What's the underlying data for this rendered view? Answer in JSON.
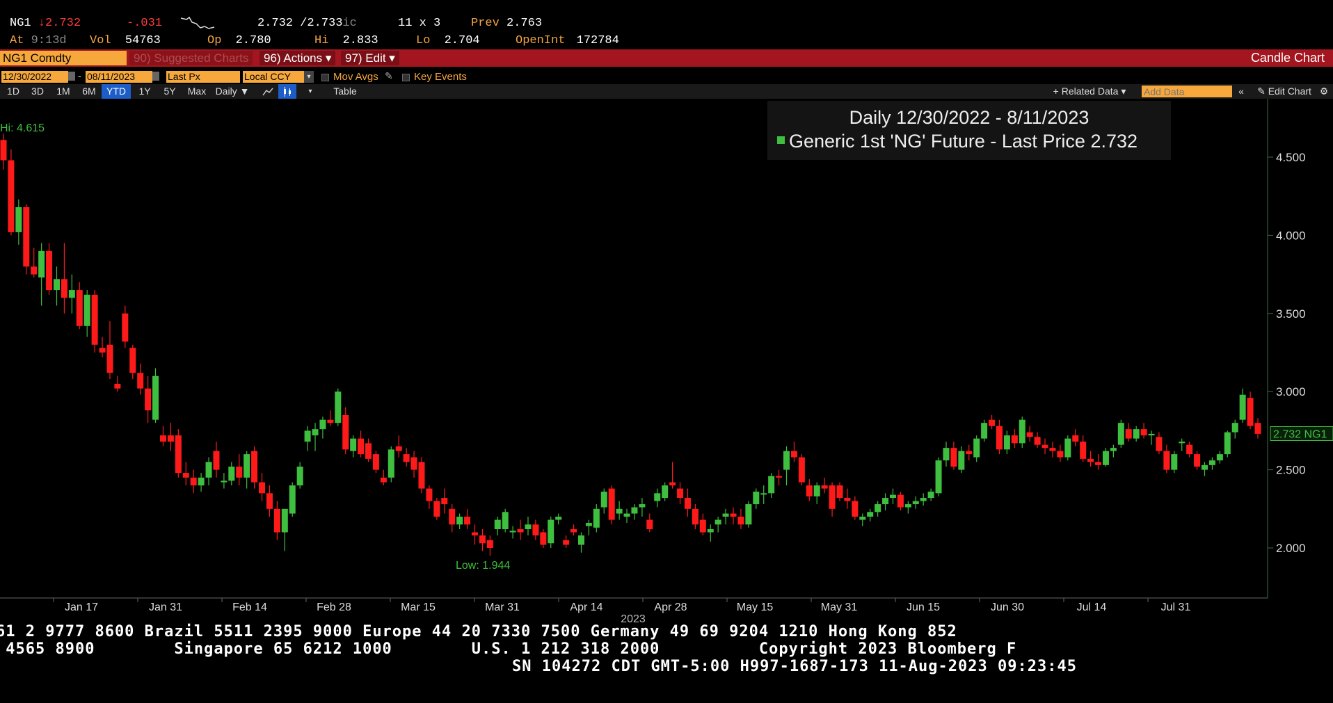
{
  "quote": {
    "ticker": "NG1",
    "arrow": "↓",
    "last": "2.732",
    "change": "-.031",
    "bid_ask": "2.732 /2.733",
    "bid_ask_suffix": "ic",
    "size": "11 x 3",
    "prev_label": "Prev",
    "prev": "2.763",
    "at_label": "At",
    "time": "9:13",
    "time_suffix": "d",
    "vol_label": "Vol",
    "vol": "54763",
    "op_label": "Op",
    "op": "2.780",
    "hi_label": "Hi",
    "hi": "2.833",
    "lo_label": "Lo",
    "lo": "2.704",
    "oi_label": "OpenInt",
    "oi": "172784"
  },
  "menu": {
    "security": "NG1 Comdty",
    "suggested": "90) Suggested Charts",
    "actions": "96) Actions ▾",
    "edit": "97) Edit ▾",
    "chart_type": "Candle Chart"
  },
  "options": {
    "start_date": "12/30/2022",
    "sep": "-",
    "end_date": "08/11/2023",
    "field": "Last Px",
    "currency": "Local CCY",
    "mov_avgs": "Mov Avgs",
    "key_events": "Key Events"
  },
  "ranges": [
    "1D",
    "3D",
    "1M",
    "6M",
    "YTD",
    "1Y",
    "5Y",
    "Max"
  ],
  "active_range": "YTD",
  "toolbar": {
    "period": "Daily ▼",
    "table": "Table",
    "related": "+ Related Data ▾",
    "add_data_placeholder": "Add Data",
    "edit_chart": "Edit Chart"
  },
  "legend": {
    "title": "Daily 12/30/2022 - 8/11/2023",
    "series": "Generic 1st 'NG' Future - Last Price",
    "value": "2.732"
  },
  "colors": {
    "up": "#3fbf3f",
    "down": "#ff1a1a",
    "menu": "#a3161f",
    "accent": "#f7a83c"
  },
  "chart_data": {
    "type": "candlestick",
    "y_ticks": [
      "4.500",
      "4.000",
      "3.500",
      "3.000",
      "2.500",
      "2.000"
    ],
    "ylim": [
      1.72,
      4.9
    ],
    "x_tick_labels": [
      "Jan 17",
      "Jan 31",
      "Feb 14",
      "Feb 28",
      "Mar 15",
      "Mar 31",
      "Apr 14",
      "Apr 28",
      "May 15",
      "May 31",
      "Jun 15",
      "Jun 30",
      "Jul 14",
      "Jul 31"
    ],
    "year_label": "2023",
    "hi_annotation": "Hi: 4.615",
    "low_annotation": "Low: 1.944",
    "last_price_tag": "2.732 NG1",
    "candles": [
      [
        4.61,
        4.65,
        4.42,
        4.48
      ],
      [
        4.48,
        4.55,
        4.0,
        4.02
      ],
      [
        4.02,
        4.23,
        3.94,
        4.18
      ],
      [
        4.18,
        4.2,
        3.75,
        3.8
      ],
      [
        3.8,
        3.92,
        3.73,
        3.75
      ],
      [
        3.73,
        3.95,
        3.55,
        3.9
      ],
      [
        3.9,
        3.95,
        3.62,
        3.65
      ],
      [
        3.65,
        3.8,
        3.55,
        3.72
      ],
      [
        3.72,
        3.95,
        3.5,
        3.6
      ],
      [
        3.6,
        3.75,
        3.5,
        3.65
      ],
      [
        3.65,
        3.7,
        3.4,
        3.42
      ],
      [
        3.42,
        3.65,
        3.35,
        3.62
      ],
      [
        3.62,
        3.65,
        3.25,
        3.3
      ],
      [
        3.28,
        3.35,
        3.22,
        3.25
      ],
      [
        3.3,
        3.45,
        3.08,
        3.12
      ],
      [
        3.05,
        3.1,
        3.0,
        3.02
      ],
      [
        3.5,
        3.55,
        3.28,
        3.32
      ],
      [
        3.28,
        3.3,
        3.08,
        3.12
      ],
      [
        3.12,
        3.18,
        2.98,
        3.02
      ],
      [
        3.02,
        3.1,
        2.8,
        2.88
      ],
      [
        2.82,
        3.15,
        2.8,
        3.1
      ],
      [
        2.72,
        2.78,
        2.65,
        2.68
      ],
      [
        2.72,
        2.8,
        2.62,
        2.68
      ],
      [
        2.72,
        2.76,
        2.45,
        2.48
      ],
      [
        2.48,
        2.55,
        2.4,
        2.45
      ],
      [
        2.45,
        2.5,
        2.35,
        2.4
      ],
      [
        2.4,
        2.48,
        2.36,
        2.45
      ],
      [
        2.45,
        2.58,
        2.4,
        2.55
      ],
      [
        2.62,
        2.68,
        2.45,
        2.5
      ],
      [
        2.42,
        2.48,
        2.38,
        2.43
      ],
      [
        2.43,
        2.55,
        2.4,
        2.52
      ],
      [
        2.52,
        2.6,
        2.4,
        2.45
      ],
      [
        2.45,
        2.62,
        2.38,
        2.6
      ],
      [
        2.62,
        2.65,
        2.38,
        2.42
      ],
      [
        2.42,
        2.48,
        2.3,
        2.35
      ],
      [
        2.35,
        2.4,
        2.2,
        2.25
      ],
      [
        2.25,
        2.3,
        2.05,
        2.1
      ],
      [
        2.1,
        2.15,
        1.98,
        2.25
      ],
      [
        2.22,
        2.42,
        2.2,
        2.4
      ],
      [
        2.4,
        2.55,
        2.38,
        2.52
      ],
      [
        2.68,
        2.78,
        2.62,
        2.75
      ],
      [
        2.72,
        2.8,
        2.62,
        2.76
      ],
      [
        2.76,
        2.84,
        2.7,
        2.82
      ],
      [
        2.82,
        2.88,
        2.78,
        2.8
      ],
      [
        2.8,
        3.02,
        2.78,
        3.0
      ],
      [
        2.85,
        2.9,
        2.6,
        2.63
      ],
      [
        2.62,
        2.72,
        2.58,
        2.7
      ],
      [
        2.7,
        2.75,
        2.58,
        2.6
      ],
      [
        2.67,
        2.7,
        2.55,
        2.57
      ],
      [
        2.6,
        2.62,
        2.48,
        2.5
      ],
      [
        2.45,
        2.5,
        2.4,
        2.42
      ],
      [
        2.45,
        2.65,
        2.42,
        2.63
      ],
      [
        2.65,
        2.72,
        2.58,
        2.62
      ],
      [
        2.6,
        2.64,
        2.52,
        2.55
      ],
      [
        2.58,
        2.62,
        2.45,
        2.5
      ],
      [
        2.55,
        2.58,
        2.35,
        2.38
      ],
      [
        2.38,
        2.4,
        2.25,
        2.3
      ],
      [
        2.3,
        2.32,
        2.18,
        2.2
      ],
      [
        2.32,
        2.38,
        2.22,
        2.28
      ],
      [
        2.25,
        2.28,
        2.1,
        2.15
      ],
      [
        2.15,
        2.22,
        2.12,
        2.2
      ],
      [
        2.2,
        2.25,
        2.12,
        2.15
      ],
      [
        2.1,
        2.15,
        2.02,
        2.08
      ],
      [
        2.08,
        2.12,
        1.98,
        2.03
      ],
      [
        2.05,
        2.08,
        1.95,
        2.0
      ],
      [
        2.12,
        2.2,
        2.08,
        2.18
      ],
      [
        2.12,
        2.25,
        2.1,
        2.23
      ],
      [
        2.1,
        2.14,
        2.06,
        2.11
      ],
      [
        2.12,
        2.18,
        2.05,
        2.1
      ],
      [
        2.12,
        2.2,
        2.08,
        2.15
      ],
      [
        2.15,
        2.18,
        2.05,
        2.08
      ],
      [
        2.1,
        2.12,
        2.0,
        2.02
      ],
      [
        2.03,
        2.2,
        2.0,
        2.18
      ],
      [
        2.18,
        2.22,
        2.15,
        2.2
      ],
      [
        2.05,
        2.08,
        2.0,
        2.02
      ],
      [
        2.12,
        2.15,
        2.08,
        2.1
      ],
      [
        2.02,
        2.1,
        1.97,
        2.08
      ],
      [
        2.14,
        2.18,
        2.08,
        2.16
      ],
      [
        2.13,
        2.28,
        2.1,
        2.25
      ],
      [
        2.26,
        2.38,
        2.22,
        2.36
      ],
      [
        2.38,
        2.4,
        2.15,
        2.18
      ],
      [
        2.22,
        2.3,
        2.18,
        2.25
      ],
      [
        2.2,
        2.25,
        2.16,
        2.22
      ],
      [
        2.22,
        2.28,
        2.18,
        2.26
      ],
      [
        2.26,
        2.32,
        2.2,
        2.28
      ],
      [
        2.18,
        2.22,
        2.1,
        2.12
      ],
      [
        2.3,
        2.38,
        2.26,
        2.35
      ],
      [
        2.32,
        2.42,
        2.3,
        2.4
      ],
      [
        2.42,
        2.55,
        2.38,
        2.4
      ],
      [
        2.38,
        2.42,
        2.28,
        2.32
      ],
      [
        2.32,
        2.38,
        2.2,
        2.25
      ],
      [
        2.25,
        2.28,
        2.12,
        2.15
      ],
      [
        2.18,
        2.22,
        2.08,
        2.1
      ],
      [
        2.1,
        2.15,
        2.04,
        2.12
      ],
      [
        2.15,
        2.2,
        2.1,
        2.18
      ],
      [
        2.2,
        2.25,
        2.15,
        2.22
      ],
      [
        2.22,
        2.26,
        2.15,
        2.2
      ],
      [
        2.2,
        2.25,
        2.12,
        2.15
      ],
      [
        2.15,
        2.3,
        2.13,
        2.28
      ],
      [
        2.28,
        2.38,
        2.25,
        2.36
      ],
      [
        2.35,
        2.4,
        2.28,
        2.35
      ],
      [
        2.35,
        2.48,
        2.32,
        2.46
      ],
      [
        2.46,
        2.5,
        2.4,
        2.45
      ],
      [
        2.5,
        2.65,
        2.4,
        2.62
      ],
      [
        2.62,
        2.68,
        2.55,
        2.58
      ],
      [
        2.58,
        2.6,
        2.4,
        2.42
      ],
      [
        2.4,
        2.44,
        2.3,
        2.33
      ],
      [
        2.33,
        2.42,
        2.28,
        2.4
      ],
      [
        2.4,
        2.45,
        2.35,
        2.38
      ],
      [
        2.4,
        2.42,
        2.2,
        2.25
      ],
      [
        2.4,
        2.42,
        2.3,
        2.32
      ],
      [
        2.32,
        2.38,
        2.25,
        2.3
      ],
      [
        2.3,
        2.33,
        2.18,
        2.2
      ],
      [
        2.18,
        2.22,
        2.14,
        2.2
      ],
      [
        2.2,
        2.25,
        2.17,
        2.23
      ],
      [
        2.23,
        2.3,
        2.2,
        2.28
      ],
      [
        2.28,
        2.35,
        2.24,
        2.32
      ],
      [
        2.32,
        2.38,
        2.28,
        2.34
      ],
      [
        2.34,
        2.36,
        2.24,
        2.26
      ],
      [
        2.26,
        2.3,
        2.22,
        2.28
      ],
      [
        2.28,
        2.33,
        2.25,
        2.3
      ],
      [
        2.3,
        2.35,
        2.27,
        2.32
      ],
      [
        2.32,
        2.38,
        2.3,
        2.36
      ],
      [
        2.35,
        2.58,
        2.33,
        2.56
      ],
      [
        2.56,
        2.68,
        2.52,
        2.64
      ],
      [
        2.64,
        2.68,
        2.5,
        2.52
      ],
      [
        2.5,
        2.65,
        2.48,
        2.62
      ],
      [
        2.62,
        2.66,
        2.56,
        2.6
      ],
      [
        2.58,
        2.72,
        2.55,
        2.7
      ],
      [
        2.7,
        2.82,
        2.68,
        2.8
      ],
      [
        2.82,
        2.85,
        2.76,
        2.78
      ],
      [
        2.78,
        2.82,
        2.6,
        2.63
      ],
      [
        2.63,
        2.75,
        2.6,
        2.72
      ],
      [
        2.72,
        2.76,
        2.64,
        2.67
      ],
      [
        2.67,
        2.84,
        2.64,
        2.82
      ],
      [
        2.74,
        2.78,
        2.68,
        2.71
      ],
      [
        2.71,
        2.74,
        2.64,
        2.66
      ],
      [
        2.66,
        2.7,
        2.6,
        2.64
      ],
      [
        2.64,
        2.68,
        2.58,
        2.62
      ],
      [
        2.62,
        2.66,
        2.55,
        2.58
      ],
      [
        2.58,
        2.72,
        2.56,
        2.7
      ],
      [
        2.72,
        2.76,
        2.65,
        2.68
      ],
      [
        2.68,
        2.72,
        2.55,
        2.57
      ],
      [
        2.57,
        2.62,
        2.52,
        2.55
      ],
      [
        2.55,
        2.6,
        2.5,
        2.53
      ],
      [
        2.53,
        2.64,
        2.52,
        2.62
      ],
      [
        2.62,
        2.66,
        2.58,
        2.64
      ],
      [
        2.66,
        2.82,
        2.64,
        2.8
      ],
      [
        2.76,
        2.8,
        2.68,
        2.7
      ],
      [
        2.7,
        2.78,
        2.68,
        2.76
      ],
      [
        2.76,
        2.8,
        2.7,
        2.72
      ],
      [
        2.72,
        2.75,
        2.66,
        2.73
      ],
      [
        2.71,
        2.74,
        2.6,
        2.62
      ],
      [
        2.62,
        2.66,
        2.48,
        2.5
      ],
      [
        2.5,
        2.62,
        2.48,
        2.6
      ],
      [
        2.67,
        2.7,
        2.62,
        2.68
      ],
      [
        2.66,
        2.68,
        2.58,
        2.6
      ],
      [
        2.6,
        2.62,
        2.5,
        2.52
      ],
      [
        2.5,
        2.55,
        2.46,
        2.53
      ],
      [
        2.53,
        2.58,
        2.5,
        2.56
      ],
      [
        2.56,
        2.62,
        2.54,
        2.6
      ],
      [
        2.6,
        2.75,
        2.58,
        2.74
      ],
      [
        2.74,
        2.82,
        2.7,
        2.8
      ],
      [
        2.82,
        3.02,
        2.8,
        2.98
      ],
      [
        2.96,
        3.0,
        2.76,
        2.78
      ],
      [
        2.8,
        2.83,
        2.7,
        2.73
      ]
    ]
  },
  "footer": {
    "line1": "61 2 9777 8600 Brazil 5511 2395 9000 Europe 44 20 7330 7500 Germany 49 69 9204 1210 Hong Kong 852",
    "line2": " 4565 8900        Singapore 65 6212 1000        U.S. 1 212 318 2000          Copyright 2023 Bloomberg F",
    "line3": "SN 104272 CDT  GMT-5:00 H997-1687-173 11-Aug-2023 09:23:45"
  }
}
